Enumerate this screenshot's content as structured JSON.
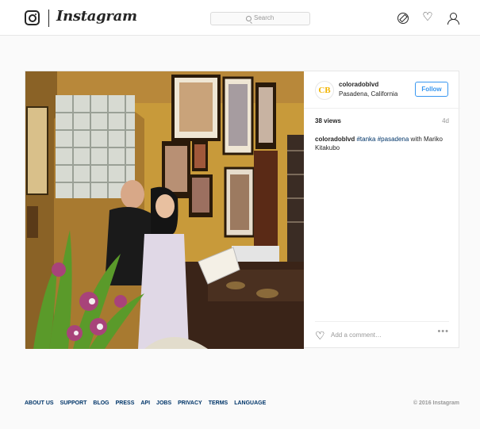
{
  "app": {
    "wordmark": "Instagram"
  },
  "search": {
    "placeholder": "Search"
  },
  "nav": {
    "icons": [
      "explore-icon",
      "heart-icon",
      "profile-icon"
    ]
  },
  "post": {
    "avatar_text": "CB",
    "username": "coloradoblvd",
    "location": "Pasadena, California",
    "follow_label": "Follow",
    "views": "38 views",
    "time": "4d",
    "caption": {
      "user": "coloradoblvd",
      "tag1": "#tanka",
      "tag2": "#pasadena",
      "text": " with Mariko Kitakubo"
    },
    "add_comment_placeholder": "Add a comment…",
    "more": "•••"
  },
  "footer": {
    "links": [
      "About us",
      "Support",
      "Blog",
      "Press",
      "API",
      "Jobs",
      "Privacy",
      "Terms",
      "Language"
    ],
    "copyright": "© 2016 Instagram"
  },
  "colors": {
    "link": "#003569",
    "accent": "#3897f0",
    "border": "#e6e6e6",
    "background": "#fafafa"
  }
}
